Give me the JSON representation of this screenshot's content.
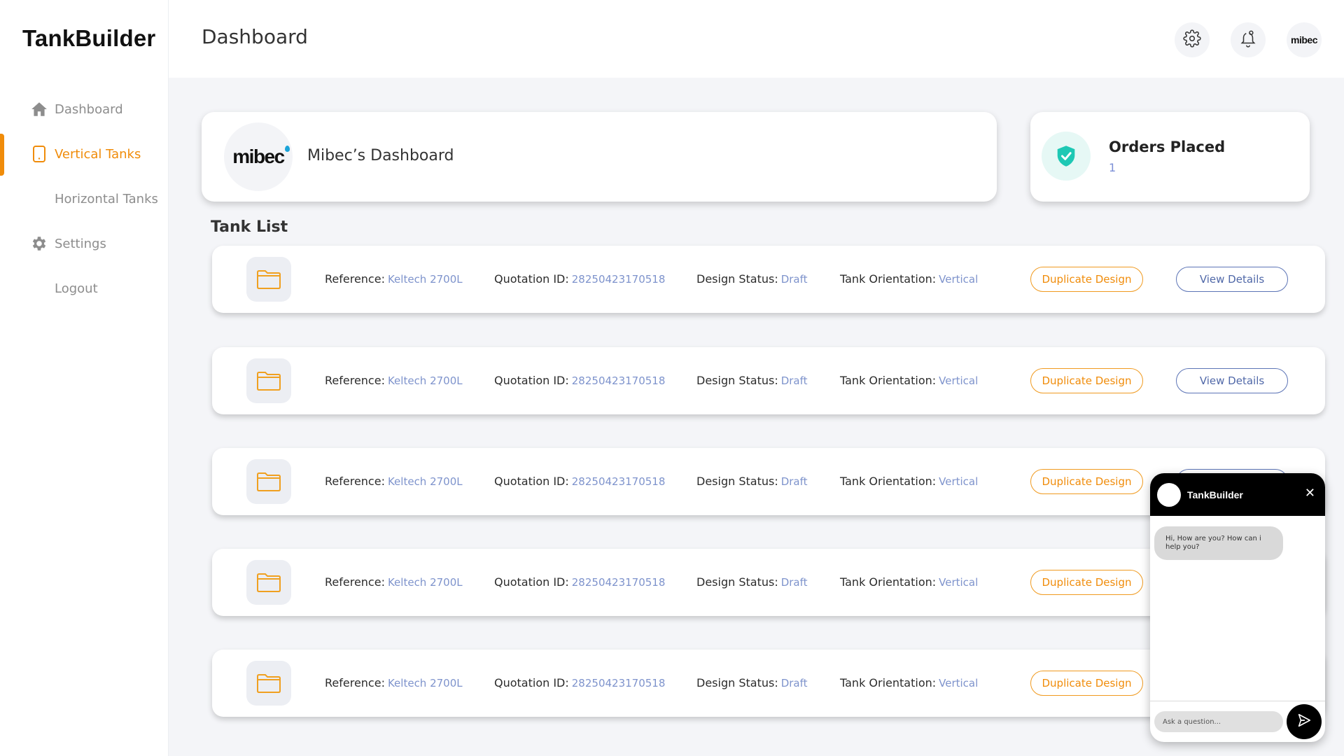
{
  "app": {
    "brand": "TankBuilder",
    "accent_color": "#f08c0a"
  },
  "sidebar": {
    "items": [
      {
        "label": "Dashboard",
        "icon": "home-icon",
        "active": false
      },
      {
        "label": "Vertical Tanks",
        "icon": "tablet-icon",
        "active": true
      },
      {
        "label": "Horizontal Tanks",
        "icon": null,
        "active": false
      },
      {
        "label": "Settings",
        "icon": "gear-icon",
        "active": false
      },
      {
        "label": "Logout",
        "icon": null,
        "active": false
      }
    ]
  },
  "header": {
    "title": "Dashboard",
    "icons": [
      "settings-icon",
      "bell-icon"
    ],
    "avatar_text": "mibec"
  },
  "dashboard_card": {
    "logo_text": "mibec",
    "title": "Mibec’s Dashboard"
  },
  "orders_card": {
    "title": "Orders Placed",
    "count": "1",
    "icon": "shield-check-icon"
  },
  "tank_list": {
    "title": "Tank List",
    "labels": {
      "reference": "Reference:",
      "quotation": "Quotation ID:",
      "status": "Design Status:",
      "orientation": "Tank Orientation:"
    },
    "duplicate_label": "Duplicate Design",
    "view_label": "View Details",
    "rows": [
      {
        "reference": "Keltech 2700L",
        "quotation_id": "28250423170518",
        "status": "Draft",
        "orientation": "Vertical"
      },
      {
        "reference": "Keltech 2700L",
        "quotation_id": "28250423170518",
        "status": "Draft",
        "orientation": "Vertical"
      },
      {
        "reference": "Keltech 2700L",
        "quotation_id": "28250423170518",
        "status": "Draft",
        "orientation": "Vertical"
      },
      {
        "reference": "Keltech 2700L",
        "quotation_id": "28250423170518",
        "status": "Draft",
        "orientation": "Vertical"
      },
      {
        "reference": "Keltech 2700L",
        "quotation_id": "28250423170518",
        "status": "Draft",
        "orientation": "Vertical"
      }
    ]
  },
  "chat": {
    "title": "TankBuilder",
    "message": "Hi, How are you? How can i help you?",
    "input_placeholder": "Ask a question..."
  }
}
